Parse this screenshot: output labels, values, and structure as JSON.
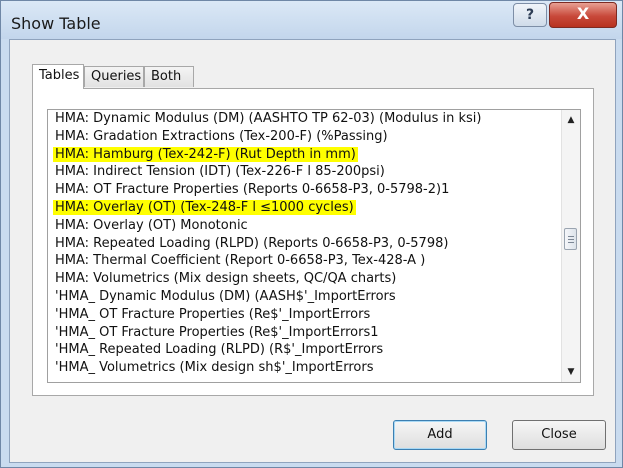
{
  "window": {
    "title": "Show Table",
    "help_glyph": "?",
    "close_glyph": "X"
  },
  "tabs": [
    {
      "label": "Tables",
      "active": true
    },
    {
      "label": "Queries",
      "active": false
    },
    {
      "label": "Both",
      "active": false
    }
  ],
  "list": {
    "items": [
      {
        "text": "HMA: Dynamic Modulus (DM) (AASHTO TP 62-03) (Modulus in ksi)",
        "highlighted": false
      },
      {
        "text": "HMA: Gradation Extractions (Tex-200-F) (%Passing)",
        "highlighted": false
      },
      {
        "text": "HMA: Hamburg (Tex-242-F) (Rut Depth in mm)",
        "highlighted": true
      },
      {
        "text": "HMA: Indirect Tension (IDT) (Tex-226-F l 85-200psi)",
        "highlighted": false
      },
      {
        "text": "HMA: OT Fracture Properties (Reports 0-6658-P3, 0-5798-2)1",
        "highlighted": false
      },
      {
        "text": "HMA: Overlay (OT) (Tex-248-F l ≤1000 cycles)",
        "highlighted": true
      },
      {
        "text": "HMA: Overlay (OT) Monotonic",
        "highlighted": false
      },
      {
        "text": "HMA: Repeated Loading (RLPD) (Reports 0-6658-P3, 0-5798)",
        "highlighted": false
      },
      {
        "text": "HMA: Thermal Coefficient (Report 0-6658-P3, Tex-428-A )",
        "highlighted": false
      },
      {
        "text": "HMA: Volumetrics (Mix design sheets, QC/QA charts)",
        "highlighted": false
      },
      {
        "text": "'HMA_ Dynamic Modulus (DM) (AASH$'_ImportErrors",
        "highlighted": false
      },
      {
        "text": "'HMA_ OT Fracture Properties (Re$'_ImportErrors",
        "highlighted": false
      },
      {
        "text": "'HMA_ OT Fracture Properties (Re$'_ImportErrors1",
        "highlighted": false
      },
      {
        "text": "'HMA_ Repeated Loading (RLPD) (R$'_ImportErrors",
        "highlighted": false
      },
      {
        "text": "'HMA_ Volumetrics (Mix design sh$'_ImportErrors",
        "highlighted": false
      }
    ],
    "highlight_color": "#ffff00"
  },
  "scrollbar": {
    "up_icon": "▲",
    "down_icon": "▼"
  },
  "buttons": {
    "add_label": "Add",
    "close_label": "Close"
  }
}
